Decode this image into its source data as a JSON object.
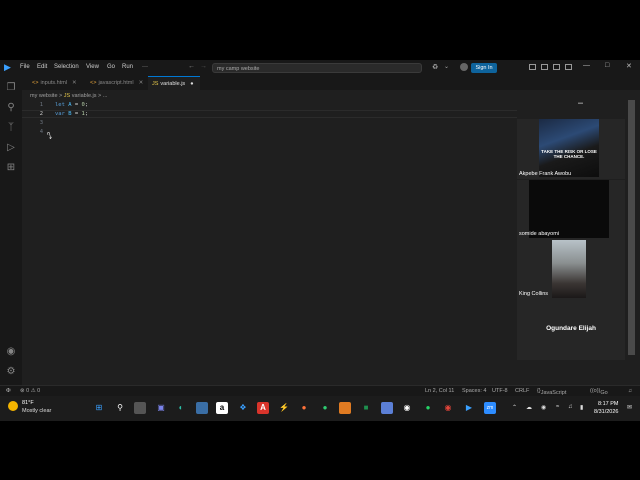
{
  "titlebar": {
    "menus": [
      "File",
      "Edit",
      "Selection",
      "View",
      "Go",
      "Run",
      "···"
    ],
    "command_center": "my camp website",
    "sign_in": "Sign In"
  },
  "tabs": [
    {
      "label": "inputs.html",
      "icon": "<>",
      "active": false
    },
    {
      "label": "javascript.html",
      "icon": "<>",
      "active": false
    },
    {
      "label": "variable.js",
      "icon": "JS",
      "active": true
    }
  ],
  "breadcrumb": {
    "folder": "my website",
    "file": "variable.js",
    "more": "..."
  },
  "editor": {
    "lines": [
      {
        "n": "1",
        "kw": "let",
        "ident": "A",
        "rest": " = ",
        "num": "0",
        "end": ";"
      },
      {
        "n": "2",
        "kw": "var",
        "ident": "B",
        "rest": " = ",
        "num": "1",
        "end": ";"
      },
      {
        "n": "3"
      },
      {
        "n": "4"
      }
    ]
  },
  "participants": [
    {
      "name": "Akpebe Frank Awobu",
      "video_caption": "TAKE THE RISK OR LOSE THE CHANCE."
    },
    {
      "name": "somide abayomi"
    },
    {
      "name": "King Collins"
    },
    {
      "name": "Ogundare Elijah"
    }
  ],
  "statusbar": {
    "errors": "⊗ 0 ⚠ 0",
    "position": "Ln 2, Col 11",
    "spaces": "Spaces: 4",
    "encoding": "UTF-8",
    "eol": "CRLF",
    "language": "JavaScript",
    "golive": "Go Live"
  },
  "taskbar": {
    "temp": "81°F",
    "weather": "Mostly clear",
    "time": "8:17 PM",
    "date": "8/31/2026"
  }
}
